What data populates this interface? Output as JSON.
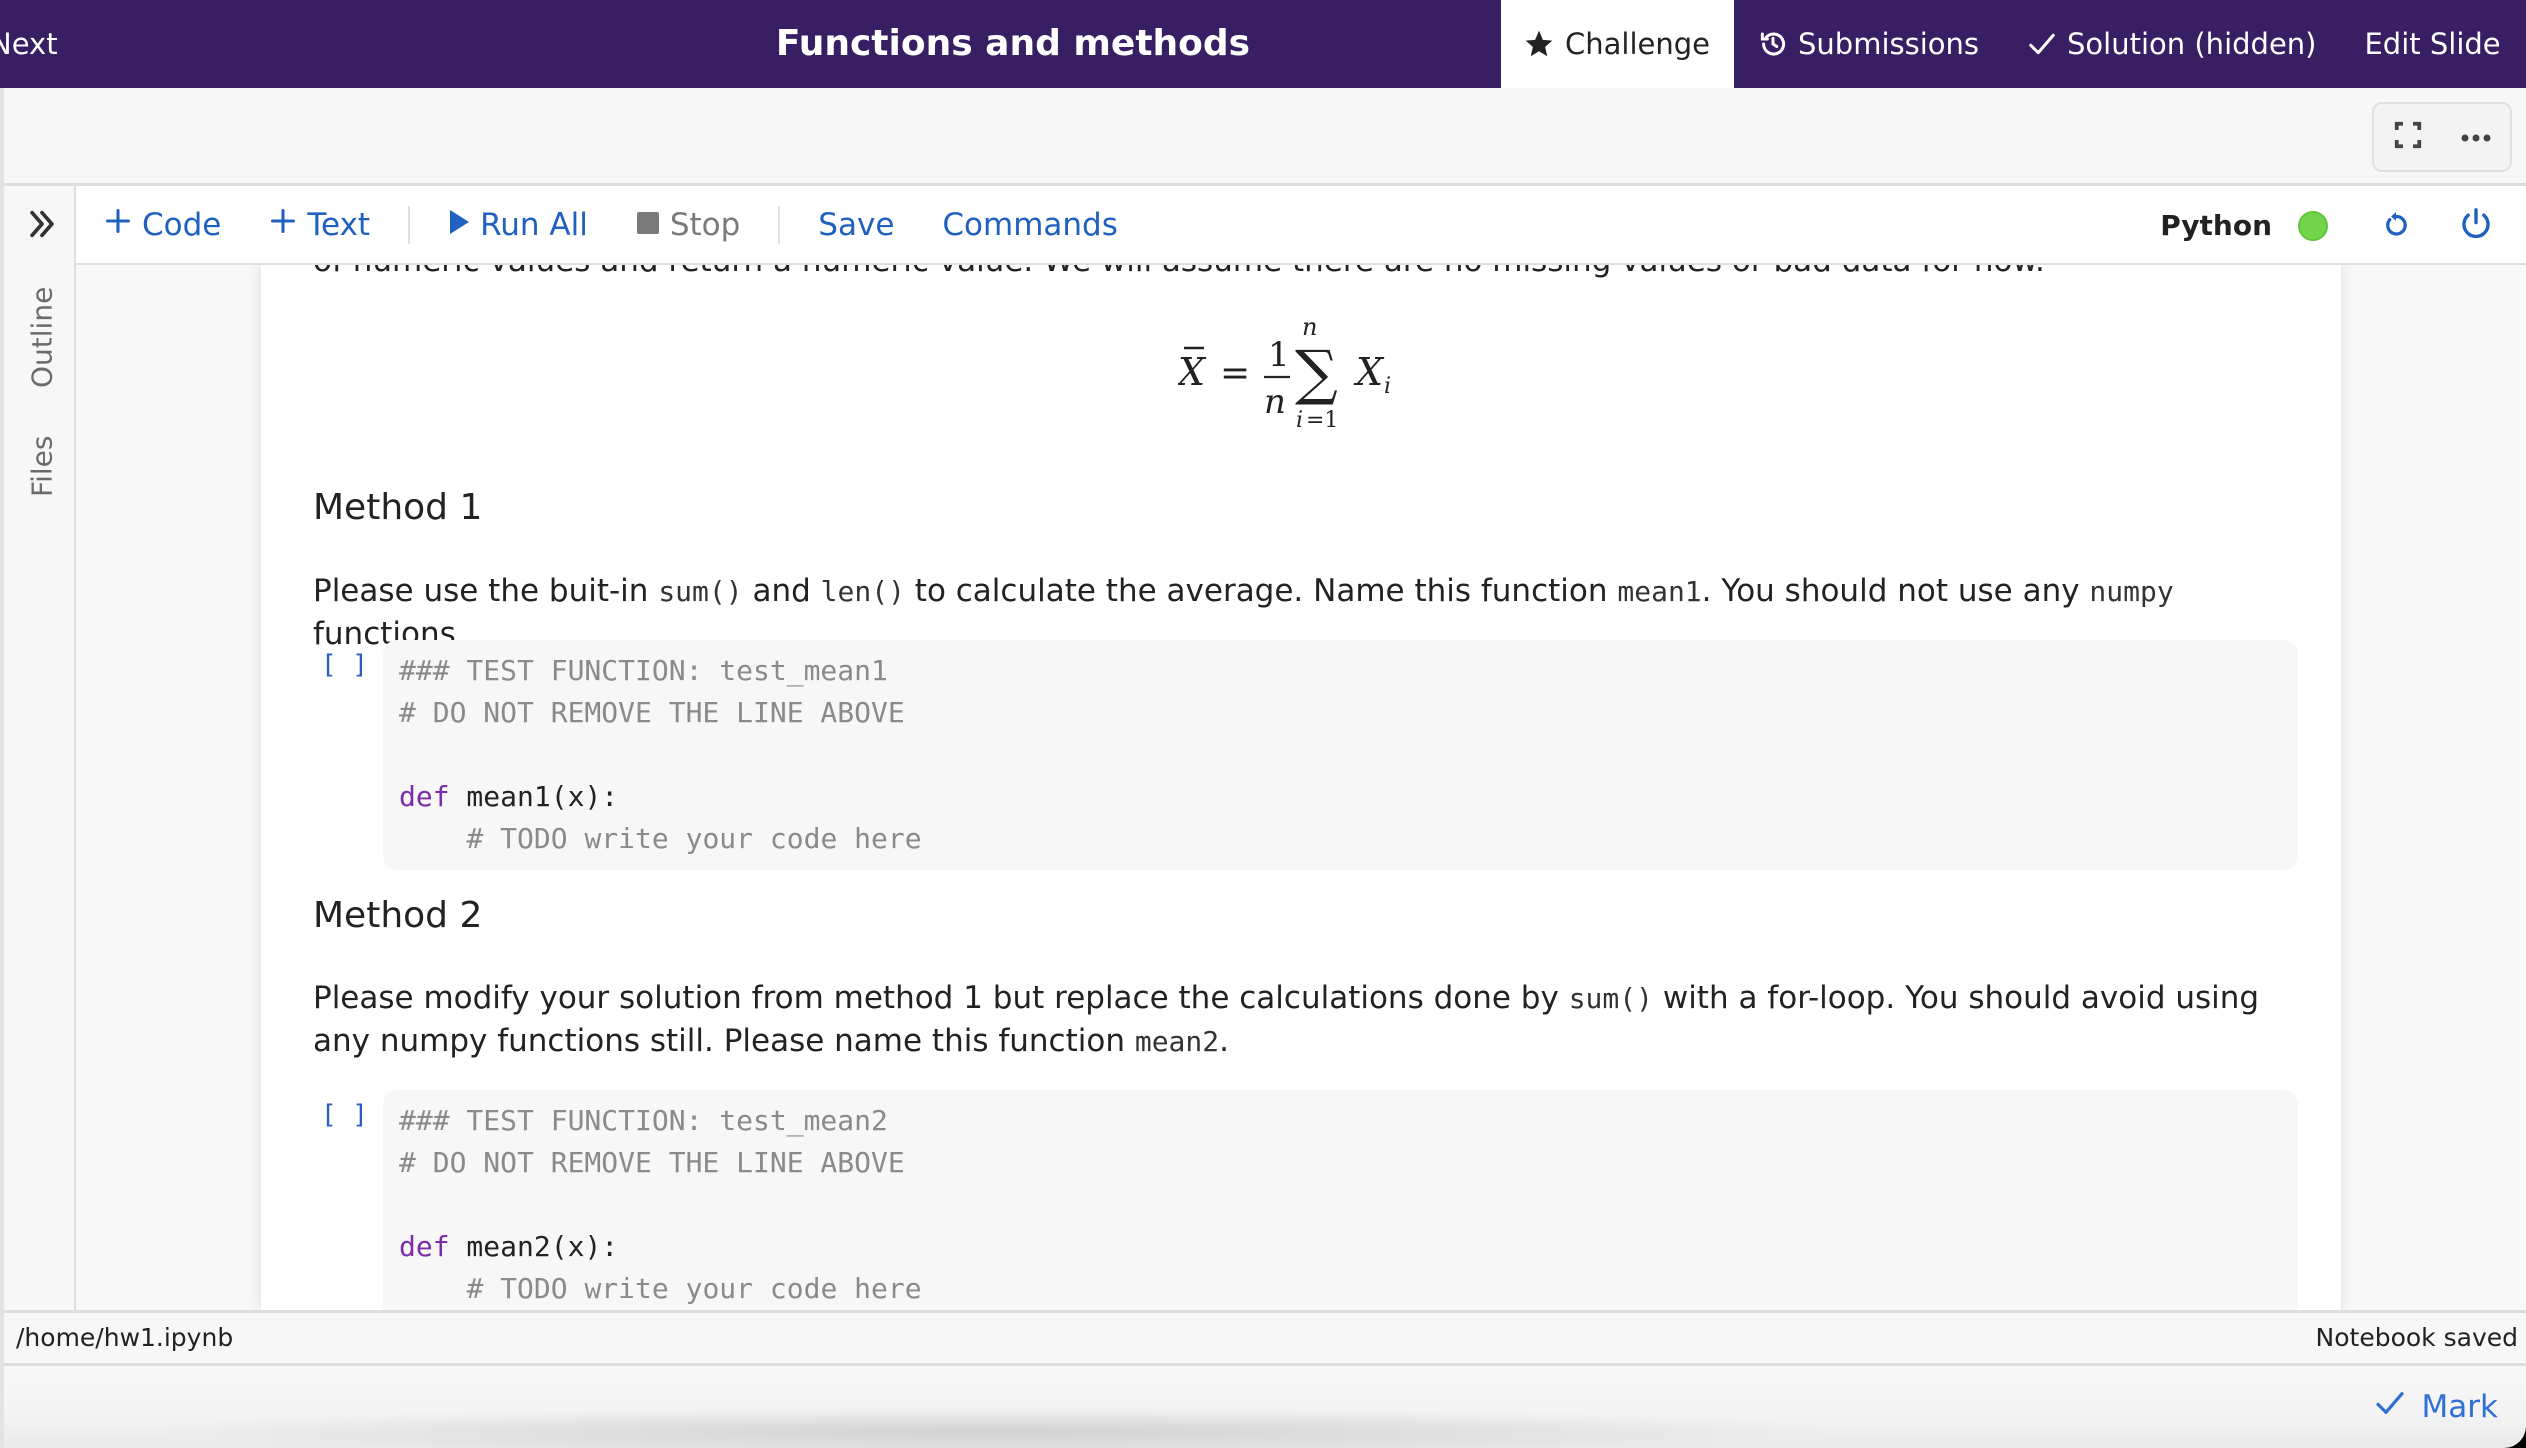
{
  "header": {
    "prev_next_label": "Next",
    "title": "Functions and methods",
    "tabs": [
      {
        "label": "Challenge",
        "icon": "star-icon",
        "active": true
      },
      {
        "label": "Submissions",
        "icon": "history-icon",
        "active": false
      },
      {
        "label": "Solution (hidden)",
        "icon": "check-icon",
        "active": false
      },
      {
        "label": "Edit Slide",
        "icon": "",
        "active": false
      }
    ],
    "more_label": "•••"
  },
  "subbar": {
    "fullscreen_icon": "fullscreen-icon",
    "more_label": "•••"
  },
  "sidebar": {
    "expand_icon": "double-chevron-right-icon",
    "tabs": [
      {
        "label": "Outline"
      },
      {
        "label": "Files"
      }
    ]
  },
  "toolbar": {
    "add_code_label": "Code",
    "add_text_label": "Text",
    "run_all_label": "Run All",
    "stop_label": "Stop",
    "save_label": "Save",
    "commands_label": "Commands",
    "kernel_name": "Python",
    "kernel_status_color": "#72d44a",
    "restart_icon": "restart-icon",
    "shutdown_icon": "power-icon"
  },
  "notebook": {
    "cutoff_text": "of numeric values and return a numeric value. We will assume there are no missing values or bad data for now.",
    "formula": "X̄ = (1/n) ∑_{i=1}^{n} X_i",
    "method1": {
      "heading": "Method 1",
      "para": [
        {
          "t": "text",
          "v": "Please use the buit-in "
        },
        {
          "t": "code",
          "v": "sum()"
        },
        {
          "t": "text",
          "v": " and "
        },
        {
          "t": "code",
          "v": "len()"
        },
        {
          "t": "text",
          "v": " to calculate the average. Name this function "
        },
        {
          "t": "code",
          "v": "mean1"
        },
        {
          "t": "text",
          "v": ". You should not use any "
        },
        {
          "t": "code",
          "v": "numpy"
        },
        {
          "t": "text",
          "v": " functions."
        }
      ],
      "cell": {
        "prompt": "[ ]",
        "lines": [
          [
            {
              "c": "comment",
              "v": "### TEST FUNCTION: test_mean1"
            }
          ],
          [
            {
              "c": "comment",
              "v": "# DO NOT REMOVE THE LINE ABOVE"
            }
          ],
          [],
          [
            {
              "c": "kw",
              "v": "def"
            },
            {
              "c": "plain",
              "v": " mean1(x):"
            }
          ],
          [
            {
              "c": "plain",
              "v": "    "
            },
            {
              "c": "comment",
              "v": "# TODO write your code here"
            }
          ]
        ]
      }
    },
    "method2": {
      "heading": "Method 2",
      "para": [
        {
          "t": "text",
          "v": "Please modify your solution from method 1 but replace the calculations done by "
        },
        {
          "t": "code",
          "v": "sum()"
        },
        {
          "t": "text",
          "v": " with a for-loop. You should avoid using any numpy functions still. Please name this function "
        },
        {
          "t": "code",
          "v": "mean2"
        },
        {
          "t": "text",
          "v": "."
        }
      ],
      "cell": {
        "prompt": "[ ]",
        "lines": [
          [
            {
              "c": "comment",
              "v": "### TEST FUNCTION: test_mean2"
            }
          ],
          [
            {
              "c": "comment",
              "v": "# DO NOT REMOVE THE LINE ABOVE"
            }
          ],
          [],
          [
            {
              "c": "kw",
              "v": "def"
            },
            {
              "c": "plain",
              "v": " mean2(x):"
            }
          ],
          [
            {
              "c": "plain",
              "v": "    "
            },
            {
              "c": "comment",
              "v": "# TODO write your code here"
            }
          ]
        ]
      }
    }
  },
  "status": {
    "path": "/home/hw1.ipynb",
    "save_state": "Notebook saved"
  },
  "footer": {
    "mark_label": "Mark"
  },
  "colors": {
    "header_bg": "#381e62",
    "accent_blue": "#2060c0",
    "keyword_purple": "#7b2ca6",
    "comment_gray": "#8a8a8a"
  }
}
